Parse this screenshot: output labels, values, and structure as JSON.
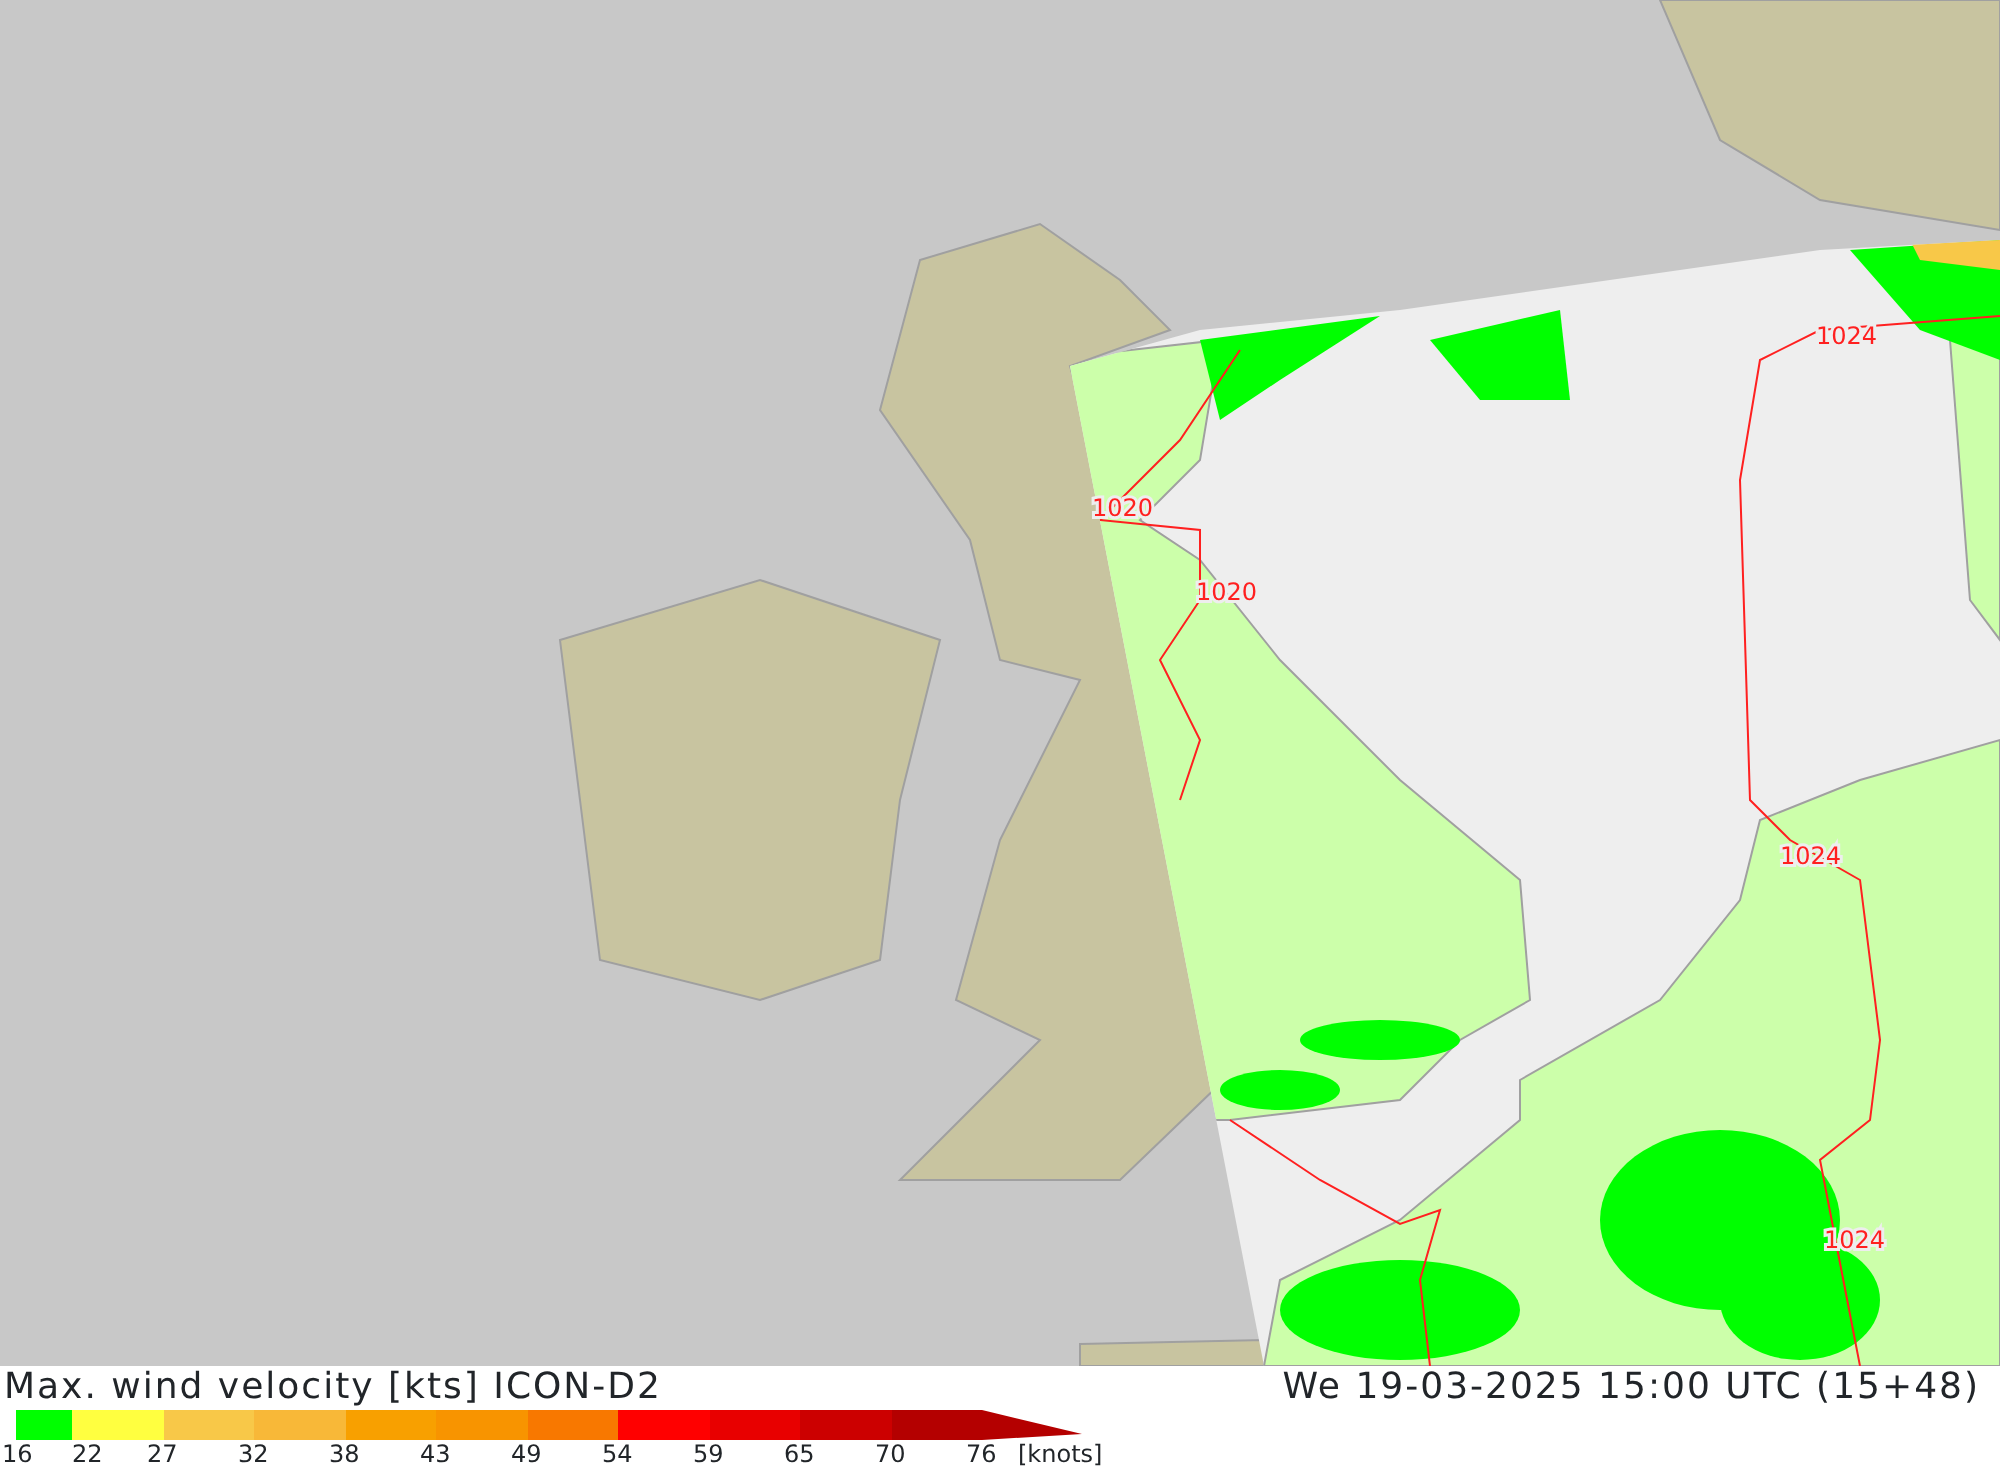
{
  "map": {
    "isobar_labels": [
      "1024",
      "1020",
      "1020",
      "1024",
      "1024"
    ]
  },
  "legend": {
    "title": "Max. wind velocity [kts] ICON-D2",
    "valid_time": "We 19-03-2025 15:00 UTC (15+48)",
    "bins": [
      {
        "color": "#00ff00"
      },
      {
        "color": "#ffff40"
      },
      {
        "color": "#f8c848"
      },
      {
        "color": "#f8b838"
      },
      {
        "color": "#f8a000"
      },
      {
        "color": "#f89400"
      },
      {
        "color": "#f87800"
      },
      {
        "color": "#ff0000"
      },
      {
        "color": "#e80000"
      },
      {
        "color": "#cc0000"
      },
      {
        "color": "#b40000"
      }
    ],
    "ticks": [
      "16",
      "22",
      "27",
      "32",
      "38",
      "43",
      "49",
      "54",
      "59",
      "65",
      "70",
      "76"
    ],
    "unit": "[knots]"
  }
}
